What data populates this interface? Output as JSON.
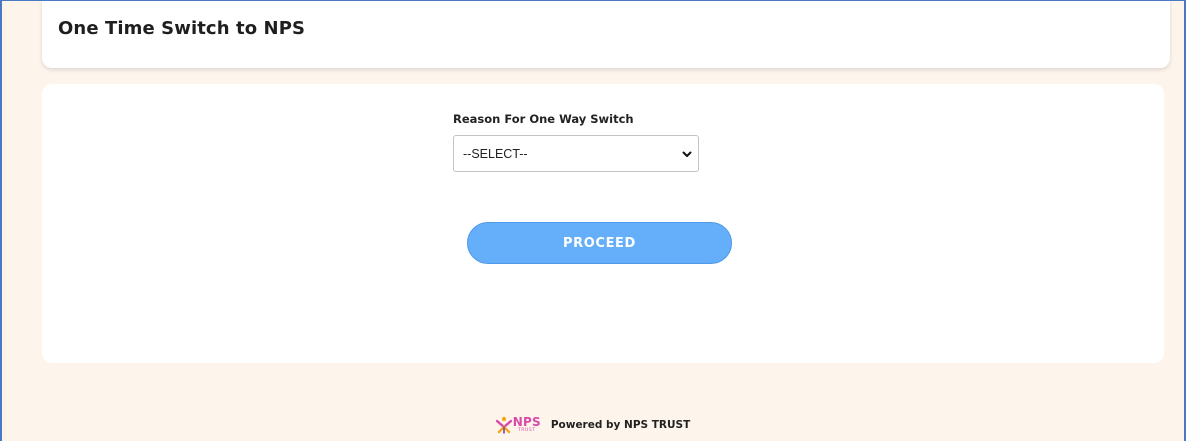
{
  "header": {
    "title": "One Time Switch to NPS"
  },
  "form": {
    "reason_label": "Reason For One Way Switch",
    "reason_select": {
      "selected": "--SELECT--"
    },
    "proceed_label": "PROCEED"
  },
  "footer": {
    "logo_text": "NPS",
    "logo_subtext": "TRUST",
    "powered_by": "Powered by NPS TRUST"
  },
  "colors": {
    "page_background": "#fdf5ec",
    "button_background": "#64aefa",
    "logo_pink": "#d94aa6",
    "frame_border": "#4a78c2"
  },
  "icons": {
    "select_arrow": "chevron-down-icon",
    "logo": "nps-trust-logo"
  }
}
